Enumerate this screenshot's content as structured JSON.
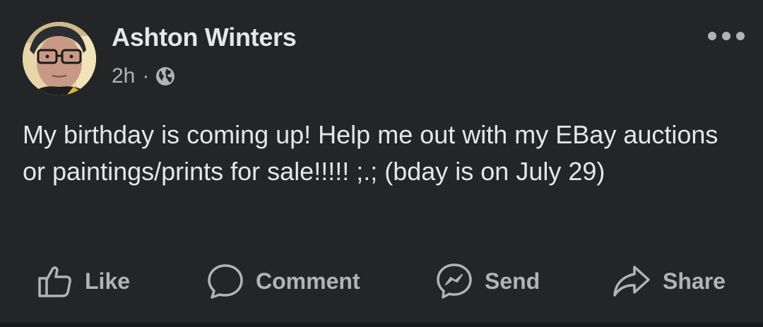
{
  "post": {
    "author": "Ashton Winters",
    "time": "2h",
    "separator": "·",
    "audience_icon": "globe-icon",
    "more_icon": "ellipsis-icon",
    "text": "My birthday is coming up! Help me out with my EBay auctions or paintings/prints for sale!!!!! ;.; (bday is on July 29)"
  },
  "actions": [
    {
      "label": "Like",
      "icon": "thumbs-up-icon"
    },
    {
      "label": "Comment",
      "icon": "comment-bubble-icon"
    },
    {
      "label": "Send",
      "icon": "messenger-icon"
    },
    {
      "label": "Share",
      "icon": "share-arrow-icon"
    }
  ],
  "colors": {
    "background": "#242526",
    "primary_text": "#e4e6eb",
    "secondary_text": "#b0b3b8"
  }
}
